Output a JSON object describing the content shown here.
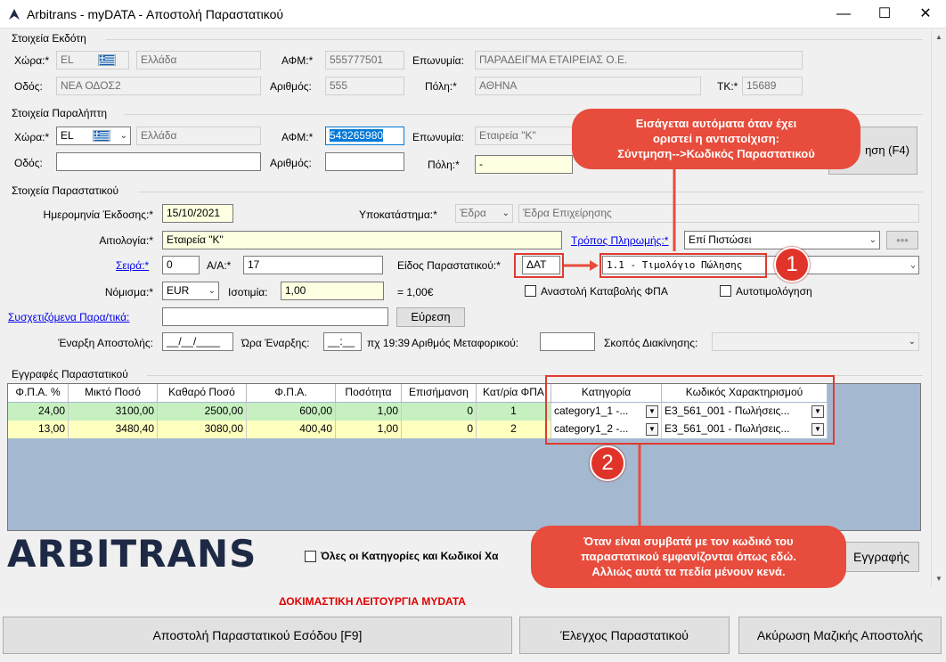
{
  "window": {
    "title": "Arbitrans - myDATA - Αποστολή Παραστατικού",
    "minimize": "—",
    "maximize": "☐",
    "close": "✕"
  },
  "issuer": {
    "section": "Στοιχεία Εκδότη",
    "country_label": "Χώρα:*",
    "country_code": "EL",
    "country_name": "Ελλάδα",
    "afm_label": "ΑΦΜ:*",
    "afm": "555777501",
    "name_label": "Επωνυμία:",
    "name": "ΠΑΡΑΔΕΙΓΜΑ ΕΤΑΙΡΕΙΑΣ Ο.Ε.",
    "street_label": "Οδός:",
    "street": "ΝΕΑ ΟΔΟΣ2",
    "number_label": "Αριθμός:",
    "number": "555",
    "city_label": "Πόλη:*",
    "city": "ΑΘΗΝΑ",
    "zip_label": "ΤΚ:*",
    "zip": "15689"
  },
  "recipient": {
    "section": "Στοιχεία Παραλήπτη",
    "country_label": "Χώρα:*",
    "country_code": "EL",
    "country_name": "Ελλάδα",
    "afm_label": "ΑΦΜ:*",
    "afm": "543265980",
    "name_label": "Επωνυμία:",
    "name": "Εταιρεία \"Κ\"",
    "street_label": "Οδός:",
    "street": "",
    "number_label": "Αριθμός:",
    "number": "",
    "city_label": "Πόλη:*",
    "city": "-",
    "search_btn": "ηση (F4)"
  },
  "document": {
    "section": "Στοιχεία Παραστατικού",
    "issue_date_label": "Ημερομηνία Έκδοσης:*",
    "issue_date": "15/10/2021",
    "branch_label": "Υποκατάστημα:*",
    "branch": "Έδρα",
    "branch_desc": "Έδρα Επιχείρησης",
    "reason_label": "Αιτιολογία:*",
    "reason": "Εταιρεία \"Κ\"",
    "payment_label": "Τρόπος Πληρωμής:*",
    "payment": "Επί Πιστώσει",
    "more_btn": "•••",
    "series_label": "Σειρά:*",
    "series": "0",
    "aa_label": "Α/Α:*",
    "aa": "17",
    "type_label": "Είδος Παραστατικού:*",
    "type_code": "ΔΑΤ",
    "type_value": "1.1 - Τιμολόγιο Πώλησης",
    "currency_label": "Νόμισμα:*",
    "currency": "EUR",
    "rate_label": "Ισοτιμία:",
    "rate": "1,00",
    "rate_result": "= 1,00€",
    "vat_suspend_label": "Αναστολή Καταβολής ΦΠΑ",
    "self_invoice_label": "Αυτοτιμολόγηση",
    "related_label": "Συσχετιζόμενα Παρα/τικά:",
    "related": "",
    "find_btn": "Εύρεση",
    "start_label": "Έναρξη Αποστολής:",
    "start_value": "__/__/____",
    "time_label": "Ώρα Έναρξης:",
    "time_value": "__:__",
    "time_hint": "πχ 19:39",
    "vehicle_label": "Αριθμός Μεταφορικού:",
    "vehicle": "",
    "purpose_label": "Σκοπός Διακίνησης:",
    "purpose": ""
  },
  "entries": {
    "section": "Εγγραφές Παραστατικού",
    "columns": [
      "Φ.Π.Α. %",
      "Μικτό Ποσό",
      "Καθαρό Ποσό",
      "Φ.Π.Α.",
      "Ποσότητα",
      "Επισήμανση",
      "Κατ/ρία ΦΠΑ",
      "Κατηγορία",
      "Κωδικός Χαρακτηρισμού"
    ],
    "rows": [
      [
        "24,00",
        "3100,00",
        "2500,00",
        "600,00",
        "1,00",
        "0",
        "1",
        "category1_1 -...",
        "E3_561_001 - Πωλήσεις..."
      ],
      [
        "13,00",
        "3480,40",
        "3080,00",
        "400,40",
        "1,00",
        "0",
        "2",
        "category1_2 -...",
        "E3_561_001 - Πωλήσεις..."
      ]
    ],
    "row_colors": [
      "#c6f0c0",
      "#ffffc0"
    ],
    "all_categories_label": "Όλες οι Κατηγορίες και Κωδικοί Χα",
    "record_btn": "Εγγραφής"
  },
  "logo": "ARBITRANS",
  "test_mode": "ΔΟΚΙΜΑΣΤΙΚΗ ΛΕΙΤΟΥΡΓΙΑ MYDATA",
  "footer": {
    "send_btn": "Αποστολή Παραστατικού Εσόδου [F9]",
    "check_btn": "Έλεγχος Παραστατικού",
    "cancel_btn": "Ακύρωση Μαζικής Αποστολής"
  },
  "annotations": {
    "callout_top": [
      "Εισάγεται αυτόματα όταν έχει",
      "οριστεί η αντιστοίχιση:",
      "Σύντμηση-->Κωδικός Παραστατικού"
    ],
    "callout_bottom": [
      "Όταν είναι συμβατά με τον κωδικό του",
      "παραστατικού εμφανίζονται όπως εδώ.",
      "Αλλιώς αυτά τα πεδία μένουν κενά."
    ],
    "badge1": "1",
    "badge2": "2"
  },
  "colors": {
    "accent_red": "#e74c3c",
    "grid_bg": "#a4b8d0",
    "required_yellow": "#ffffe1"
  }
}
